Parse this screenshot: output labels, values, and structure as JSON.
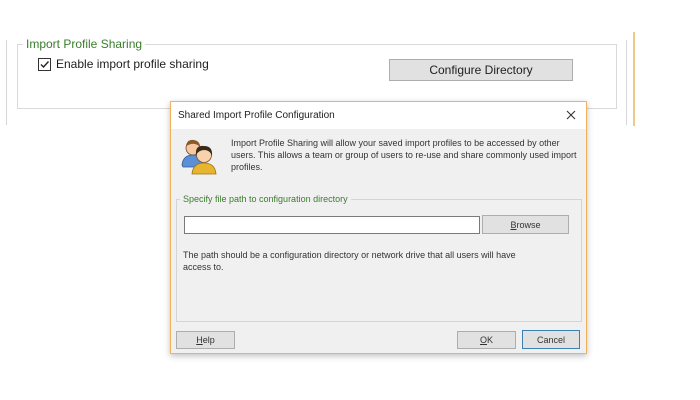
{
  "background": {
    "group_title": "Import Profile Sharing",
    "checkbox_label": "Enable import profile sharing",
    "checkbox_checked": true,
    "configure_button": "Configure Directory"
  },
  "dialog": {
    "title": "Shared Import Profile Configuration",
    "info_text": "Import Profile Sharing will allow your saved import profiles to be accessed by other users. This allows a team or group of users to re-use and share commonly used import profiles.",
    "group_title": "Specify file path to configuration directory",
    "path_value": "",
    "browse_label_accel": "B",
    "browse_label_rest": "rowse",
    "note_text": "The path should be a configuration directory or network drive that all users will have access to.",
    "help_accel": "H",
    "help_rest": "elp",
    "ok_accel": "O",
    "ok_rest": "K",
    "cancel_label": "Cancel"
  },
  "icons": {
    "users_icon": "two-users-icon",
    "close_icon": "close-icon",
    "check_icon": "checkmark-icon"
  },
  "colors": {
    "accent_green": "#3a7d2c",
    "dialog_border": "#f0b25c",
    "default_button_border": "#3c7fb1"
  }
}
